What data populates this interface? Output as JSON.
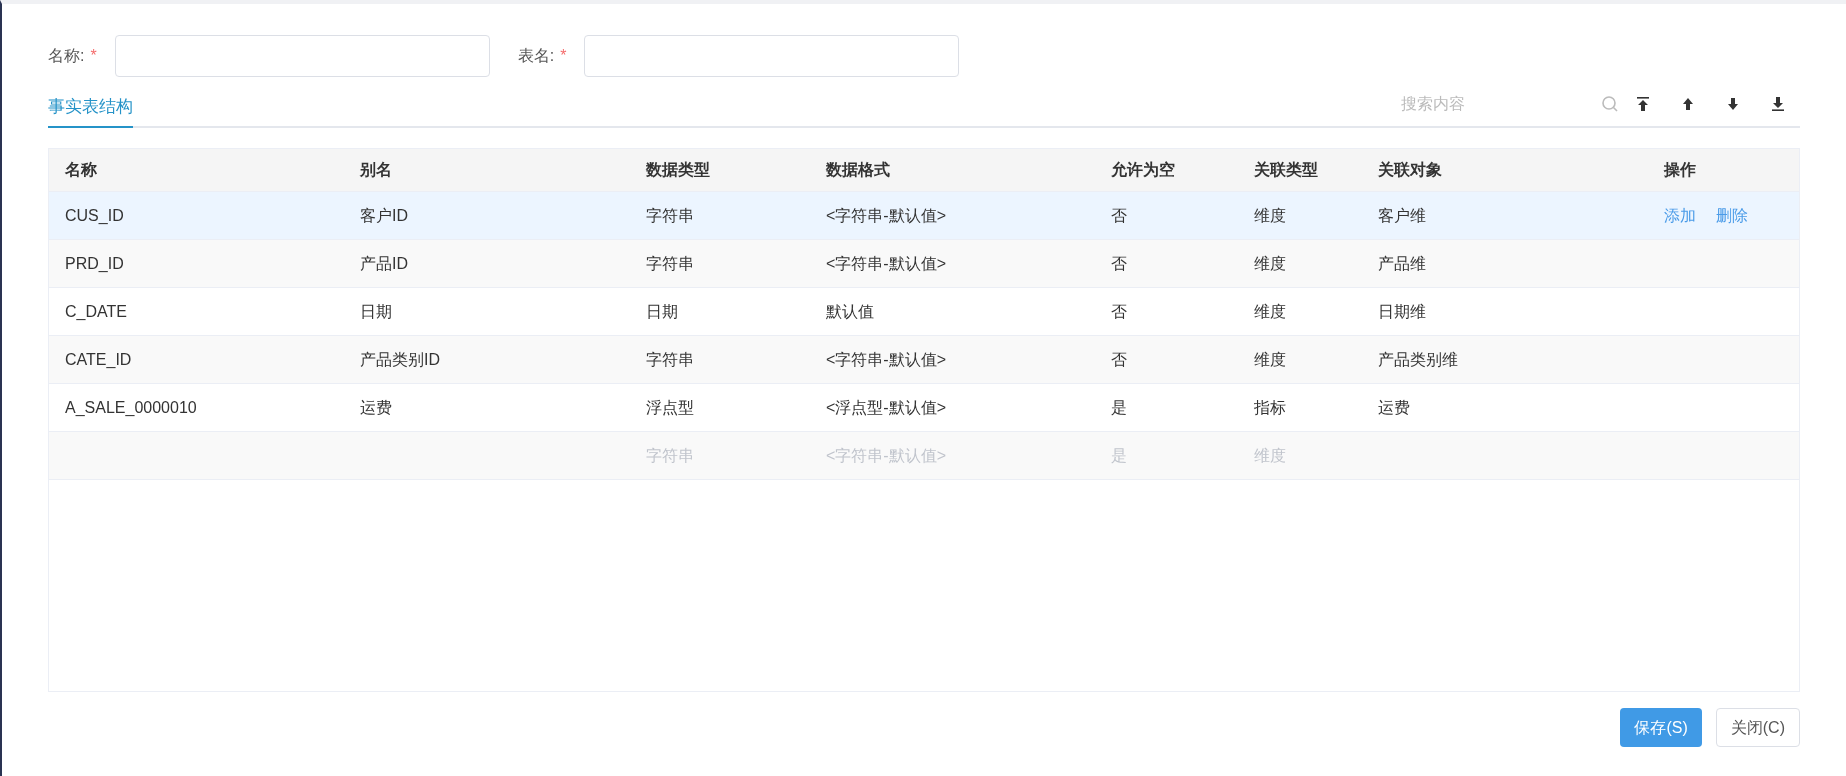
{
  "form": {
    "fields": [
      {
        "label": "名称:",
        "required_mark": "*"
      },
      {
        "label": "表名:",
        "required_mark": "*"
      }
    ]
  },
  "tabs": [
    {
      "label": "事实表结构",
      "selected": true
    }
  ],
  "toolbar": {
    "search": {
      "placeholder": "搜索内容"
    },
    "buttons": [
      {
        "kind": "top"
      },
      {
        "kind": "up"
      },
      {
        "kind": "down"
      },
      {
        "kind": "bottom"
      }
    ]
  },
  "table": {
    "columns": [
      "名称",
      "别名",
      "数据类型",
      "数据格式",
      "允许为空",
      "关联类型",
      "关联对象",
      "操作"
    ],
    "rows": [
      {
        "selected": true,
        "disabled": false,
        "cells": [
          "CUS_ID",
          "客户ID",
          "字符串",
          "<字符串-默认值>",
          "否",
          "维度",
          "客户维"
        ],
        "actions": [
          "添加",
          "删除"
        ]
      },
      {
        "selected": false,
        "disabled": false,
        "cells": [
          "PRD_ID",
          "产品ID",
          "字符串",
          "<字符串-默认值>",
          "否",
          "维度",
          "产品维"
        ]
      },
      {
        "selected": false,
        "disabled": false,
        "cells": [
          "C_DATE",
          "日期",
          "日期",
          "默认值",
          "否",
          "维度",
          "日期维"
        ]
      },
      {
        "selected": false,
        "disabled": false,
        "cells": [
          "CATE_ID",
          "产品类别ID",
          "字符串",
          "<字符串-默认值>",
          "否",
          "维度",
          "产品类别维"
        ]
      },
      {
        "selected": false,
        "disabled": false,
        "cells": [
          "A_SALE_0000010",
          "运费",
          "浮点型",
          "<浮点型-默认值>",
          "是",
          "指标",
          "运费"
        ]
      },
      {
        "selected": false,
        "disabled": true,
        "cells": [
          "",
          "",
          "字符串",
          "<字符串-默认值>",
          "是",
          "维度",
          ""
        ]
      }
    ]
  },
  "footer": {
    "buttons": [
      {
        "label": "保存(S)",
        "kind": "primary"
      },
      {
        "label": "关闭(C)",
        "kind": "default"
      }
    ]
  }
}
